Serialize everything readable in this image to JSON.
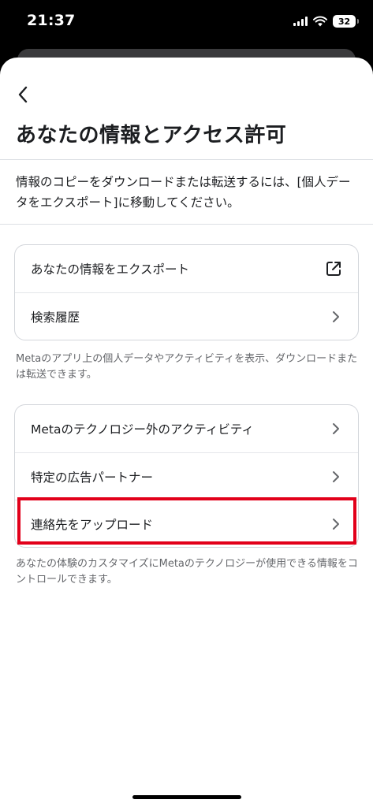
{
  "status_bar": {
    "time": "21:37",
    "battery": "32"
  },
  "header": {
    "back_icon": "chevron-left-icon",
    "title": "あなたの情報とアクセス許可"
  },
  "intro": {
    "text": "情報のコピーをダウンロードまたは転送するには、[個人データをエクスポート]に移動してください。"
  },
  "section1": {
    "items": [
      {
        "label": "あなたの情報をエクスポート",
        "icon": "external-link-icon"
      },
      {
        "label": "検索履歴",
        "icon": "chevron-right-icon"
      }
    ],
    "caption": "Metaのアプリ上の個人データやアクティビティを表示、ダウンロードまたは転送できます。"
  },
  "section2": {
    "items": [
      {
        "label": "Metaのテクノロジー外のアクティビティ",
        "icon": "chevron-right-icon"
      },
      {
        "label": "特定の広告パートナー",
        "icon": "chevron-right-icon"
      },
      {
        "label": "連絡先をアップロード",
        "icon": "chevron-right-icon",
        "highlighted": true
      }
    ],
    "caption": "あなたの体験のカスタマイズにMetaのテクノロジーが使用できる情報をコントロールできます。"
  },
  "colors": {
    "highlight": "#e2001a",
    "caption": "#65676b",
    "text": "#1c1e21"
  }
}
